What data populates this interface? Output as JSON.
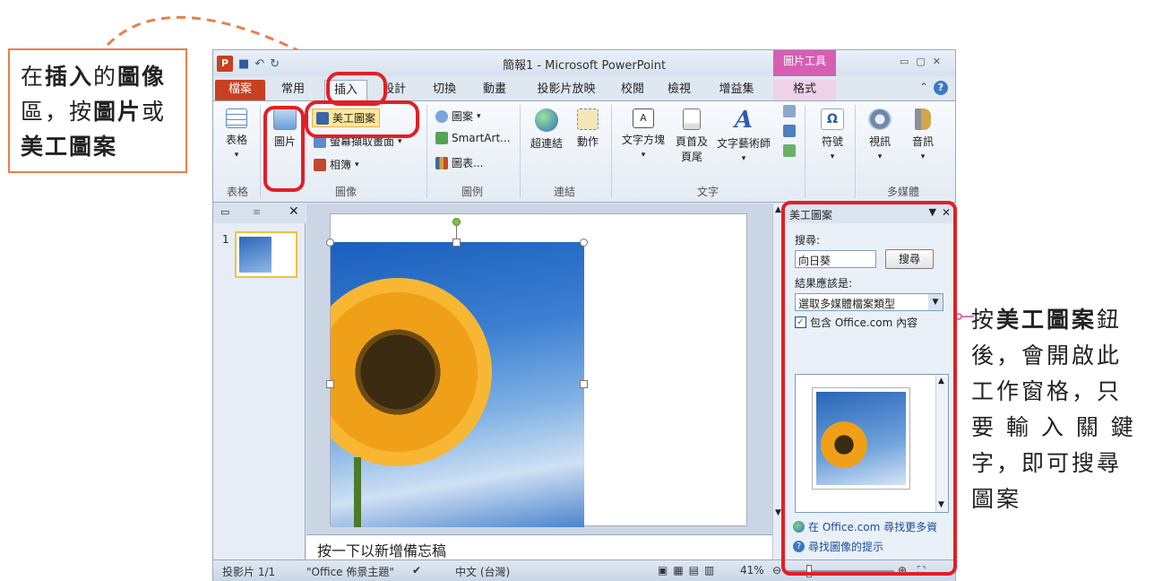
{
  "callouts": {
    "left_pre": "在",
    "left_bold1": "插入",
    "left_mid": "的",
    "left_bold2": "圖像",
    "left_line2a": "區，按",
    "left_bold3": "圖片",
    "left_line2b": "或",
    "left_bold4": "美工圖案",
    "right_pre": "按",
    "right_bold": "美工圖案",
    "right_rest1": "鈕",
    "right_line2": "後，會開啟此",
    "right_line3": "工作窗格，只",
    "right_line4": "要 輸 入 關 鍵",
    "right_line5": "字，即可搜尋",
    "right_line6": "圖案"
  },
  "window": {
    "title": "簡報1 - Microsoft PowerPoint",
    "context_tools": "圖片工具",
    "qat_icon": "P"
  },
  "tabs": [
    "檔案",
    "常用",
    "插入",
    "設計",
    "切換",
    "動畫",
    "投影片放映",
    "校閱",
    "檢視",
    "增益集",
    "格式"
  ],
  "ribbon": {
    "table": "表格",
    "picture": "圖片",
    "clipart": "美工圖案",
    "screenshot": "螢幕擷取畫面",
    "album": "相簿",
    "shapes": "圖案",
    "smartart": "SmartArt...",
    "chart": "圖表...",
    "hyperlink": "超連結",
    "action": "動作",
    "textbox": "文字方塊",
    "header_footer_1": "頁首及",
    "header_footer_2": "頁尾",
    "wordart": "文字藝術師",
    "symbol": "符號",
    "video": "視訊",
    "audio": "音訊",
    "groups": {
      "tables": "表格",
      "images": "圖像",
      "illustrations": "圖例",
      "links": "連結",
      "text": "文字",
      "media": "多媒體"
    }
  },
  "slide_pane": {
    "number": "1"
  },
  "notes_placeholder": "按一下以新增備忘稿",
  "task_pane": {
    "title": "美工圖案",
    "search_label": "搜尋:",
    "search_value": "向日葵",
    "search_button": "搜尋",
    "results_label": "結果應該是:",
    "results_select": "選取多媒體檔案類型",
    "include_office": "包含 Office.com 內容",
    "link_more": "在 Office.com 尋找更多資",
    "link_tips": "尋找圖像的提示"
  },
  "status": {
    "slide": "投影片 1/1",
    "theme": "\"Office 佈景主題\"",
    "lang": "中文 (台灣)",
    "zoom": "41%"
  },
  "colors": {
    "file_tab": "#c8401f",
    "context_tab": "#d65fb3",
    "highlight": "#e21f26",
    "callout_border": "#e8804a"
  }
}
